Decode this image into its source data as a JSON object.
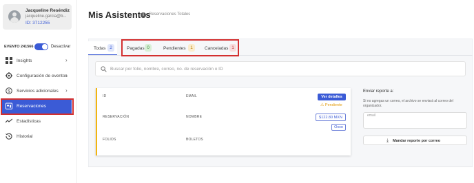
{
  "user": {
    "name": "Jacqueline Reséndiz",
    "email": "jacqueline.garcia@b...",
    "id_label": "ID: 3712255"
  },
  "event": {
    "label": "EVENTO 241566",
    "toggle_state": "Desactivar"
  },
  "sidebar": {
    "items": [
      {
        "label": "Insights",
        "icon": "grid-icon",
        "chevron": "›"
      },
      {
        "label": "Configuración de eventos",
        "icon": "gear-icon",
        "chevron": "›"
      },
      {
        "label": "Servicios adicionales",
        "icon": "dollar-icon",
        "chevron": "›"
      },
      {
        "label": "Reservaciones",
        "icon": "reservations-icon"
      },
      {
        "label": "Estadísticas",
        "icon": "trend-icon"
      },
      {
        "label": "Historial",
        "icon": "history-icon"
      }
    ]
  },
  "page": {
    "title": "Mis Asistentes",
    "subtitle": "Reservaciones Totales",
    "info_glyph": "i"
  },
  "tabs": [
    {
      "label": "Todas",
      "count": "2"
    },
    {
      "label": "Pagadas",
      "count": "0"
    },
    {
      "label": "Pendientes",
      "count": "1"
    },
    {
      "label": "Canceladas",
      "count": "1"
    }
  ],
  "search": {
    "placeholder": "Buscar por folio, nombre, correo, no. de reservación o ID"
  },
  "reservation": {
    "labels": {
      "id": "ID",
      "email": "EMAIL",
      "reservation": "RESERVACIÓN",
      "name": "NOMBRE",
      "folios": "FOLIOS",
      "tickets": "BOLETOS"
    },
    "details_button": "Ver detalles",
    "status": "Pendiente",
    "status_glyph": "⚠",
    "price": "$122.80 MXN",
    "payment_method": "Oxxo"
  },
  "report": {
    "title": "Enviar reporte a:",
    "description": "Si no agregas un correo, el archivo se enviará al correo del organizador.",
    "email_label": "email",
    "send_button": "Mandar reporte por correo",
    "send_glyph": "⤓"
  },
  "colors": {
    "accent": "#3b5bd6",
    "highlight": "#d32f2f",
    "pending": "#e29b0b"
  }
}
